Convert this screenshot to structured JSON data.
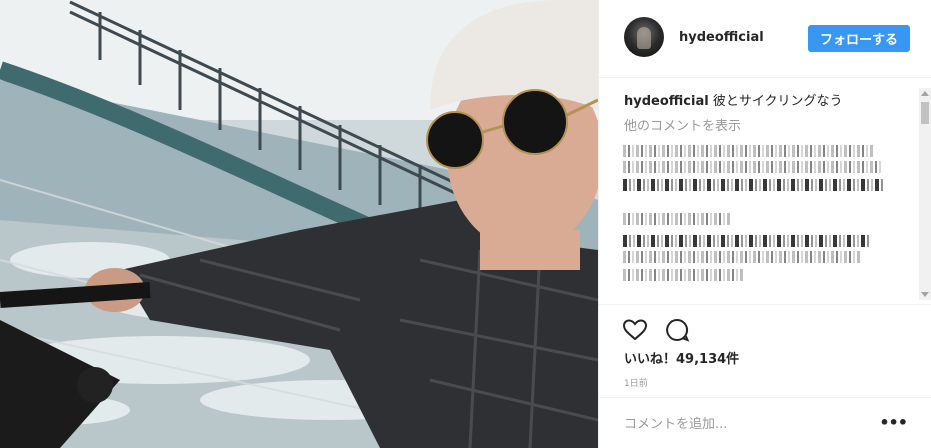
{
  "header": {
    "username": "hydeofficial",
    "follow_label": "フォローする"
  },
  "caption": {
    "username": "hydeofficial",
    "text": "彼とサイクリングなう"
  },
  "comments": {
    "more_label": "他のコメントを表示"
  },
  "likes": {
    "label": "いいね！49,134件",
    "count": 49134
  },
  "date": "1日前",
  "add_comment": {
    "placeholder": "コメントを追加...",
    "more_options": "•••"
  },
  "colors": {
    "follow_button": "#3897f0",
    "text": "#262626",
    "muted": "#999999",
    "border": "#efefef"
  },
  "icons": {
    "like": "heart-outline-icon",
    "comment": "speech-bubble-icon",
    "options": "more-horizontal-icon"
  }
}
